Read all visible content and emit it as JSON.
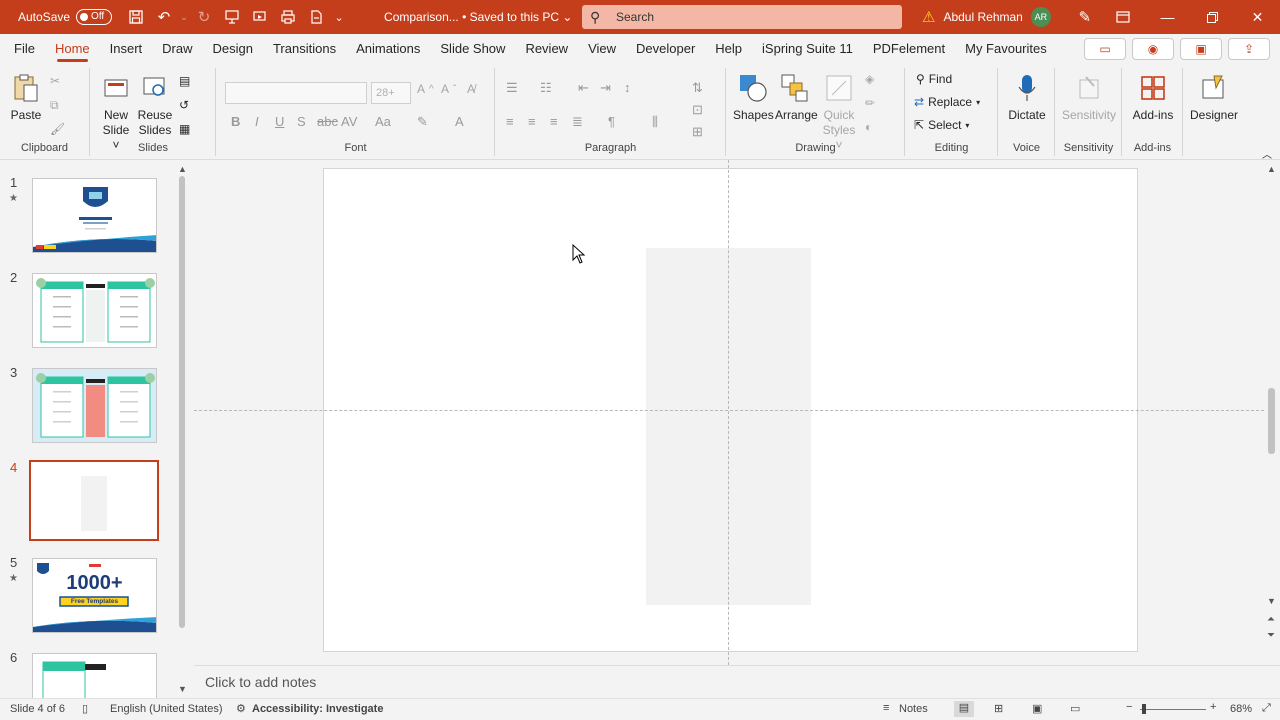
{
  "titlebar": {
    "autosave_label": "AutoSave",
    "autosave_state": "Off",
    "doc_title": "Comparison... • Saved to this PC ⌄",
    "search_placeholder": "Search",
    "user_name": "Abdul Rehman",
    "user_initials": "AR"
  },
  "tabs": [
    "File",
    "Home",
    "Insert",
    "Draw",
    "Design",
    "Transitions",
    "Animations",
    "Slide Show",
    "Review",
    "View",
    "Developer",
    "Help",
    "iSpring Suite 11",
    "PDFelement",
    "My Favourites"
  ],
  "active_tab": "Home",
  "ribbon": {
    "clipboard": {
      "label": "Clipboard",
      "paste": "Paste"
    },
    "slides": {
      "label": "Slides",
      "new_slide": "New",
      "new_slide2": "Slide ˅",
      "reuse": "Reuse",
      "reuse2": "Slides"
    },
    "font": {
      "label": "Font",
      "size": "28+"
    },
    "paragraph": {
      "label": "Paragraph"
    },
    "drawing": {
      "label": "Drawing",
      "shapes": "Shapes",
      "arrange": "Arrange",
      "quick_styles": "Quick",
      "quick_styles2": "Styles ˅"
    },
    "editing": {
      "label": "Editing",
      "find": "Find",
      "replace": "Replace",
      "select": "Select"
    },
    "voice": {
      "label": "Voice",
      "dictate": "Dictate"
    },
    "sensitivity": {
      "label": "Sensitivity",
      "btn": "Sensitivity"
    },
    "addins": {
      "label": "Add-ins",
      "btn": "Add-ins"
    },
    "designer": {
      "btn": "Designer"
    }
  },
  "thumbnails": {
    "numbers": [
      "1",
      "2",
      "3",
      "4",
      "5",
      "6"
    ],
    "thumb5_text": "1000+",
    "thumb5_sub": "Free Templates"
  },
  "notes_placeholder": "Click to add notes",
  "status": {
    "slide": "Slide 4 of 6",
    "language": "English (United States)",
    "accessibility": "Accessibility: Investigate",
    "notes": "Notes",
    "zoom": "68%"
  },
  "colors": {
    "accent": "#c43e1c",
    "teal": "#2ec4a0",
    "avatar": "#4c8f54"
  }
}
